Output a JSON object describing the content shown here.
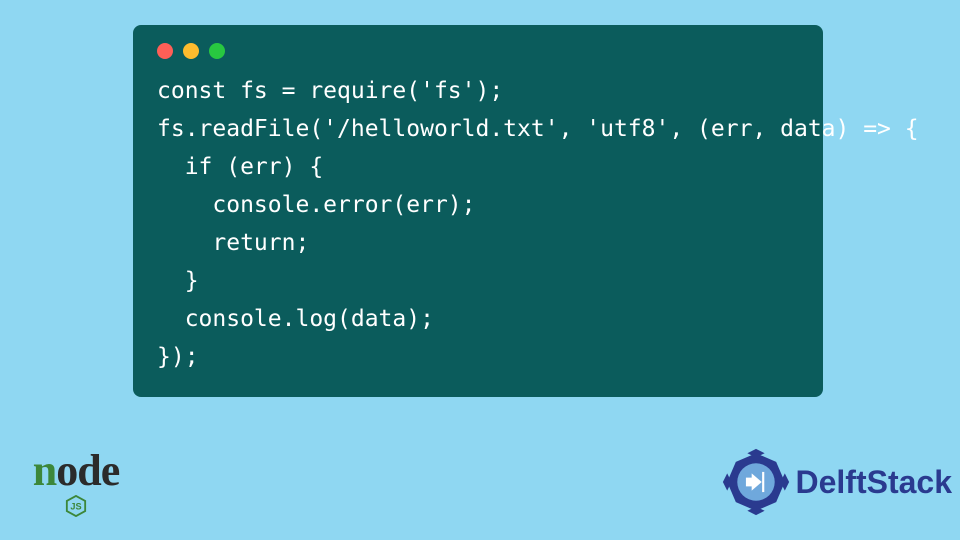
{
  "code": {
    "lines": [
      "const fs = require('fs');",
      "fs.readFile('/helloworld.txt', 'utf8', (err, data) => {",
      "  if (err) {",
      "    console.error(err);",
      "    return;",
      "  }",
      "  console.log(data);",
      "});"
    ]
  },
  "window": {
    "dot_red": "#ff5f57",
    "dot_yellow": "#febc2e",
    "dot_green": "#28c840",
    "bg": "#0b5c5c"
  },
  "logos": {
    "node": {
      "text_parts": {
        "n": "n",
        "ode": "ode"
      },
      "hex_color": "#3c873a"
    },
    "delftstack": {
      "text": "DelftStack",
      "color": "#2a3a8f"
    }
  }
}
